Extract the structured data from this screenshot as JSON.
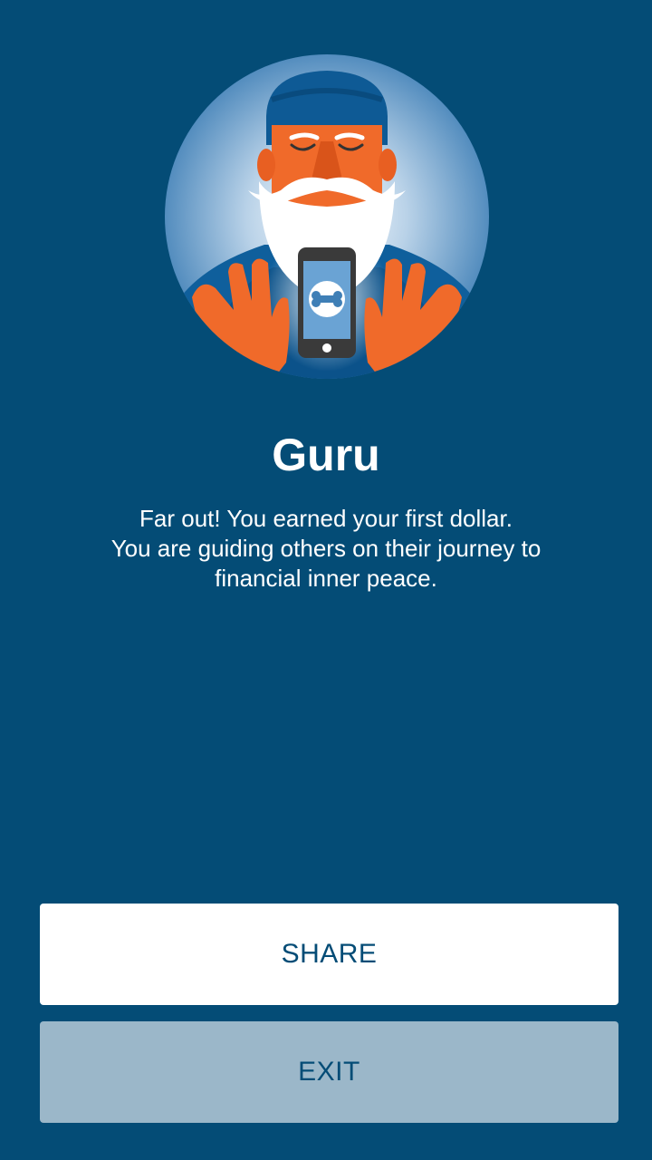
{
  "achievement": {
    "title": "Guru",
    "description_lines": [
      "Far out! You earned your first dollar.",
      "You are guiding others on their journey to",
      "financial inner peace."
    ],
    "illustration_icon": "guru-with-phone-icon"
  },
  "actions": {
    "share_label": "SHARE",
    "exit_label": "EXIT"
  },
  "colors": {
    "background": "#044c76",
    "share_button_bg": "#ffffff",
    "exit_button_bg": "#9bb7c9",
    "button_text": "#044c76",
    "accent_orange": "#f06a2a"
  }
}
